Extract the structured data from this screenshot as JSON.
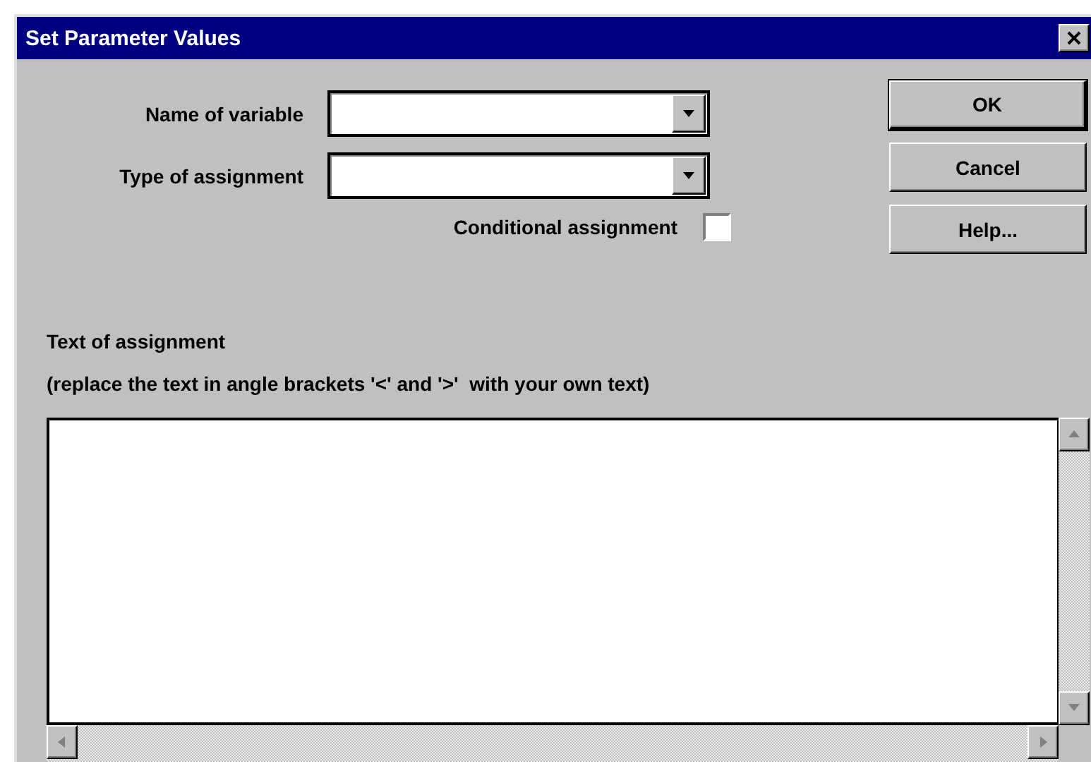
{
  "window": {
    "title": "Set Parameter Values"
  },
  "fields": [
    {
      "label": "Name of variable"
    },
    {
      "label": "Type of assignment"
    }
  ],
  "conditional": {
    "label": "Conditional assignment",
    "checked": false
  },
  "buttons": [
    {
      "label": "OK",
      "default": true
    },
    {
      "label": "Cancel",
      "default": false
    },
    {
      "label": "Help...",
      "default": false
    }
  ],
  "text_section": {
    "heading": "Text of assignment",
    "hint": "(replace the text in angle brackets '<' and '>'  with your own text)"
  }
}
